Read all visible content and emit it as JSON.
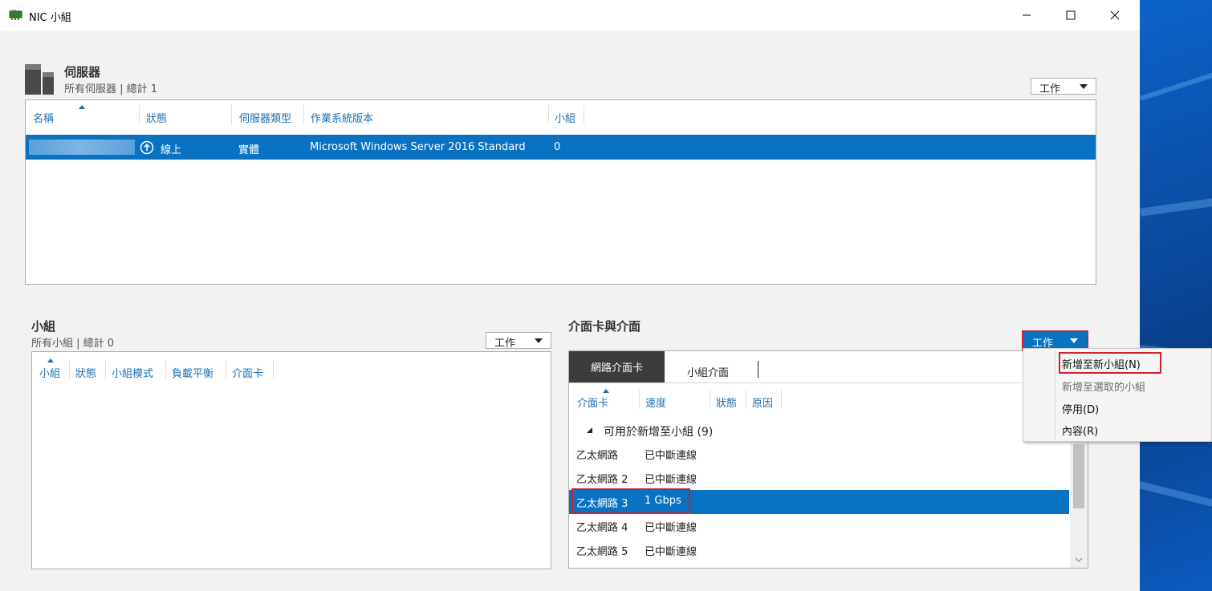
{
  "window": {
    "title": "NIC 小組"
  },
  "servers": {
    "title": "伺服器",
    "subtitle": "所有伺服器 | 總計 1",
    "task_label": "工作",
    "columns": [
      "名稱",
      "狀態",
      "伺服器類型",
      "作業系統版本",
      "小組"
    ],
    "rows": [
      {
        "name": "",
        "status": "線上",
        "type": "實體",
        "os": "Microsoft Windows Server 2016 Standard",
        "teams": "0"
      }
    ]
  },
  "teams": {
    "title": "小組",
    "subtitle": "所有小組 | 總計 0",
    "task_label": "工作",
    "columns": [
      "小組",
      "狀態",
      "小組模式",
      "負載平衡",
      "介面卡"
    ]
  },
  "adapters": {
    "title": "介面卡與介面",
    "task_label": "工作",
    "tabs": [
      "網路介面卡",
      "小組介面"
    ],
    "columns": [
      "介面卡",
      "速度",
      "狀態",
      "原因"
    ],
    "group_label": "可用於新增至小組 (9)",
    "rows": [
      {
        "name": "乙太網路",
        "speed": "已中斷連線"
      },
      {
        "name": "乙太網路 2",
        "speed": "已中斷連線"
      },
      {
        "name": "乙太網路 3",
        "speed": "1 Gbps"
      },
      {
        "name": "乙太網路 4",
        "speed": "已中斷連線"
      },
      {
        "name": "乙太網路 5",
        "speed": "已中斷連線"
      }
    ]
  },
  "context_menu": {
    "items": [
      "新增至新小組(N)",
      "新增至選取的小組",
      "停用(D)",
      "內容(R)"
    ]
  },
  "colors": {
    "selection": "#0a72c2",
    "accent_link": "#1a6fb5",
    "highlight_box": "#d0202a"
  }
}
